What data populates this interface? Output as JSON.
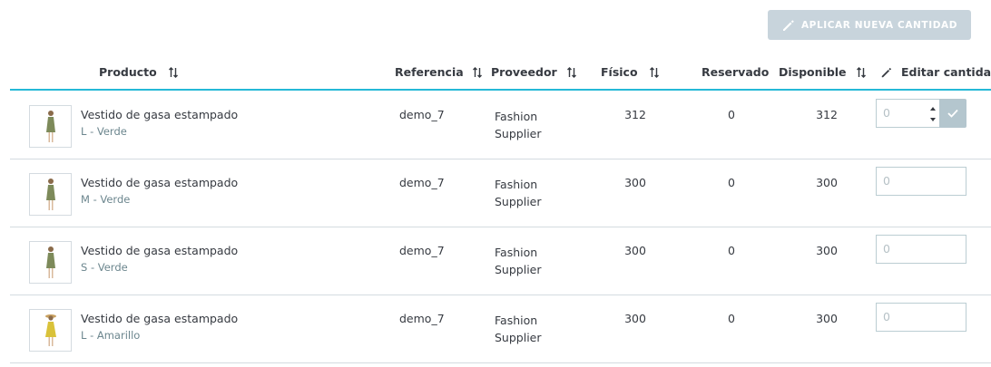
{
  "toolbar": {
    "apply_label": "APLICAR NUEVA CANTIDAD",
    "apply_icon": "pencil-icon"
  },
  "columns": {
    "product": "Producto",
    "reference": "Referencia",
    "supplier": "Proveedor",
    "physical": "Físico",
    "reserved": "Reservado",
    "available": "Disponible",
    "edit_qty": "Editar cantidad"
  },
  "rows": [
    {
      "name": "Vestido de gasa estampado",
      "attr": "L - Verde",
      "reference": "demo_7",
      "supplier_line1": "Fashion",
      "supplier_line2": "Supplier",
      "physical": "312",
      "reserved": "0",
      "available": "312",
      "qty_placeholder": "0",
      "thumb_color": "#7d8a5a"
    },
    {
      "name": "Vestido de gasa estampado",
      "attr": "M - Verde",
      "reference": "demo_7",
      "supplier_line1": "Fashion",
      "supplier_line2": "Supplier",
      "physical": "300",
      "reserved": "0",
      "available": "300",
      "qty_placeholder": "0",
      "thumb_color": "#7d8a5a"
    },
    {
      "name": "Vestido de gasa estampado",
      "attr": "S - Verde",
      "reference": "demo_7",
      "supplier_line1": "Fashion",
      "supplier_line2": "Supplier",
      "physical": "300",
      "reserved": "0",
      "available": "300",
      "qty_placeholder": "0",
      "thumb_color": "#7d8a5a"
    },
    {
      "name": "Vestido de gasa estampado",
      "attr": "L - Amarillo",
      "reference": "demo_7",
      "supplier_line1": "Fashion",
      "supplier_line2": "Supplier",
      "physical": "300",
      "reserved": "0",
      "available": "300",
      "qty_placeholder": "0",
      "thumb_color": "#d9c23a"
    }
  ],
  "colors": {
    "accent": "#25b9d7",
    "button_disabled": "#c8d4dc",
    "divider": "#d4dbe0"
  }
}
